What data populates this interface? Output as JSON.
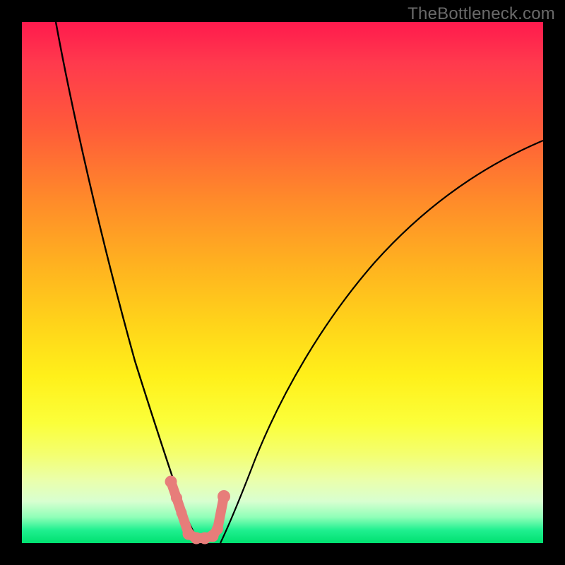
{
  "watermark": "TheBottleneck.com",
  "colors": {
    "frame": "#000000",
    "curve_stroke": "#000000",
    "marker_fill": "#e77d7a",
    "marker_stroke": "#aa4a52"
  },
  "chart_data": {
    "type": "line",
    "title": "",
    "xlabel": "",
    "ylabel": "",
    "xlim": [
      0,
      100
    ],
    "ylim": [
      0,
      100
    ],
    "grid": false,
    "series": [
      {
        "name": "left-curve",
        "x": [
          6,
          8,
          10,
          12,
          14,
          16,
          18,
          20,
          22,
          24,
          25,
          26,
          27,
          28,
          29,
          30,
          31,
          32,
          33,
          34
        ],
        "y": [
          100,
          90,
          80,
          71,
          62,
          54,
          46,
          39,
          32,
          25,
          22,
          19,
          16,
          13,
          10,
          8,
          6,
          4,
          2,
          0
        ]
      },
      {
        "name": "right-curve",
        "x": [
          38,
          39,
          40,
          42,
          44,
          46,
          48,
          50,
          54,
          58,
          62,
          66,
          70,
          74,
          78,
          82,
          86,
          90,
          94,
          98,
          100
        ],
        "y": [
          0,
          2,
          4,
          8,
          12,
          16,
          20,
          24,
          31,
          38,
          44,
          49,
          54,
          58,
          62,
          66,
          69,
          72,
          74,
          76,
          77
        ]
      },
      {
        "name": "markers-trough",
        "x": [
          28.5,
          29.6,
          30.6,
          32.0,
          33.5,
          35.0,
          36.5,
          37.5,
          38.7
        ],
        "y": [
          12.0,
          8.8,
          6.0,
          1.8,
          0.9,
          0.9,
          1.4,
          2.7,
          9.0
        ]
      }
    ],
    "marker_radius_range": [
      7,
      9
    ]
  }
}
